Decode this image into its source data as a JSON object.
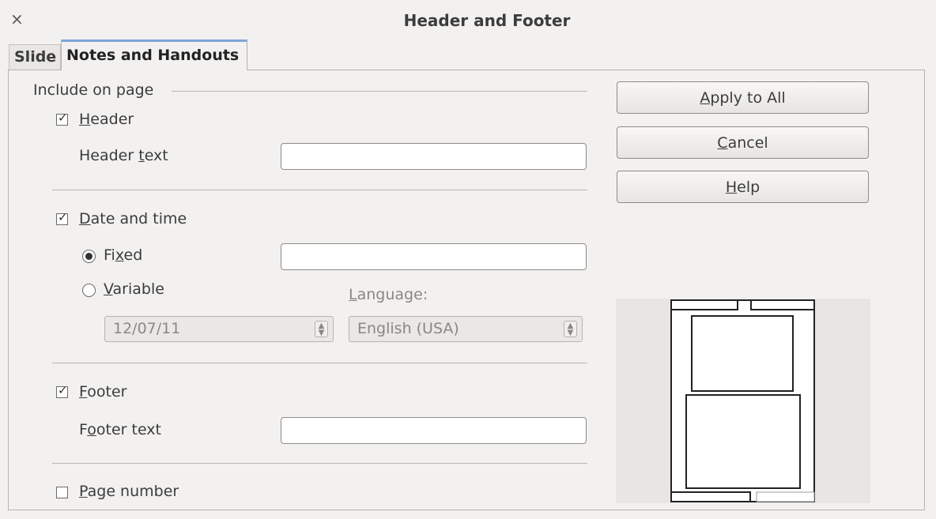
{
  "window": {
    "title": "Header and Footer",
    "close_glyph": "×"
  },
  "tabs": [
    {
      "label": "Slide",
      "active": false
    },
    {
      "label": "Notes and Handouts",
      "active": true
    }
  ],
  "section_label": "Include on page",
  "header": {
    "checkbox_pre": "",
    "checkbox_ul": "H",
    "checkbox_post": "eader",
    "checked": true,
    "text_label_pre": "Header ",
    "text_label_ul": "t",
    "text_label_post": "ext",
    "value": ""
  },
  "date_time": {
    "checkbox_pre": "",
    "checkbox_ul": "D",
    "checkbox_post": "ate and time",
    "checked": true,
    "fixed_pre": "Fi",
    "fixed_ul": "x",
    "fixed_post": "ed",
    "fixed_selected": true,
    "fixed_value": "",
    "variable_pre": "",
    "variable_ul": "V",
    "variable_post": "ariable",
    "format_value": "12/07/11",
    "language_pre": "",
    "language_ul": "L",
    "language_post": "anguage:",
    "language_value": "English (USA)"
  },
  "footer": {
    "checkbox_pre": "",
    "checkbox_ul": "F",
    "checkbox_post": "ooter",
    "checked": true,
    "text_label_pre": "F",
    "text_label_ul": "o",
    "text_label_post": "oter text",
    "value": ""
  },
  "page_number": {
    "checkbox_pre": "",
    "checkbox_ul": "P",
    "checkbox_post": "age number",
    "checked": false
  },
  "buttons": {
    "apply_pre": "",
    "apply_ul": "A",
    "apply_post": "pply to All",
    "cancel_pre": "",
    "cancel_ul": "C",
    "cancel_post": "ancel",
    "help_pre": "",
    "help_ul": "H",
    "help_post": "elp"
  },
  "check_glyph": "✓"
}
